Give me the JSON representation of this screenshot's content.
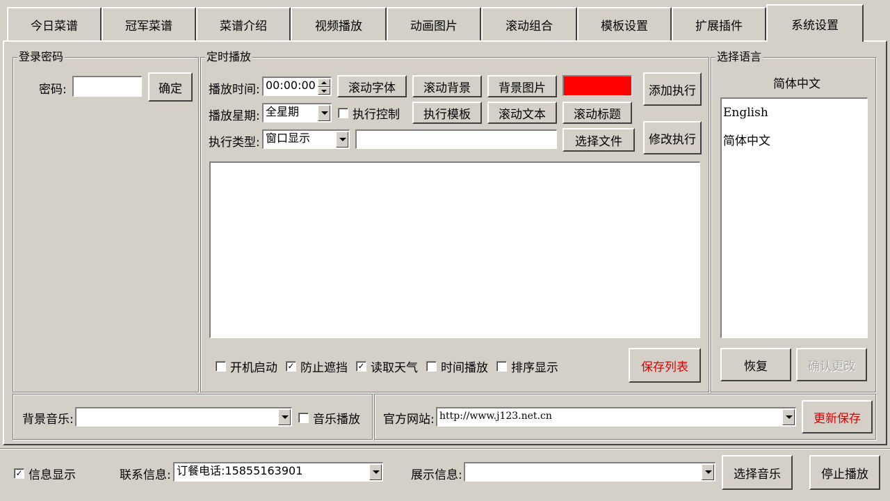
{
  "tabs": [
    "今日菜谱",
    "冠军菜谱",
    "菜谱介绍",
    "视频播放",
    "动画图片",
    "滚动组合",
    "模板设置",
    "扩展插件",
    "系统设置"
  ],
  "login": {
    "group_title": "登录密码",
    "password_label": "密码:",
    "password_value": "",
    "confirm_label": "确定"
  },
  "schedule": {
    "group_title": "定时播放",
    "time_label": "播放时间:",
    "time_value": "00:00:00",
    "weekday_label": "播放星期:",
    "weekday_value": "全星期",
    "exec_type_label": "执行类型:",
    "exec_type_value": "窗口显示",
    "file_path_value": "",
    "exec_control_label": "执行控制",
    "exec_control_checked": false,
    "buttons": {
      "scroll_font": "滚动字体",
      "scroll_bg": "滚动背景",
      "bg_image": "背景图片",
      "exec_template": "执行模板",
      "scroll_text": "滚动文本",
      "scroll_title": "滚动标题",
      "select_file": "选择文件",
      "add_exec": "添加执行",
      "modify_exec": "修改执行",
      "save_list": "保存列表"
    },
    "color_swatch": "#ff0000",
    "options": [
      {
        "label": "开机启动",
        "checked": false
      },
      {
        "label": "防止遮挡",
        "checked": true
      },
      {
        "label": "读取天气",
        "checked": true
      },
      {
        "label": "时间播放",
        "checked": false
      },
      {
        "label": "排序显示",
        "checked": false
      }
    ]
  },
  "language": {
    "group_title": "选择语言",
    "current": "简体中文",
    "items": [
      "English",
      "简体中文"
    ],
    "restore_label": "恢复",
    "confirm_change_label": "确认更改"
  },
  "bottom": {
    "bg_music_label": "背景音乐:",
    "bg_music_value": "",
    "music_play_label": "音乐播放",
    "music_play_checked": false,
    "website_label": "官方网站:",
    "website_value": "http://www.j123.net.cn",
    "update_save_label": "更新保存"
  },
  "footer": {
    "info_display_label": "信息显示",
    "info_display_checked": true,
    "contact_label": "联系信息:",
    "contact_value": "订餐电话:15855163901",
    "display_info_label": "展示信息:",
    "display_info_value": "",
    "select_music_label": "选择音乐",
    "stop_play_label": "停止播放"
  },
  "check_mark": "✓"
}
